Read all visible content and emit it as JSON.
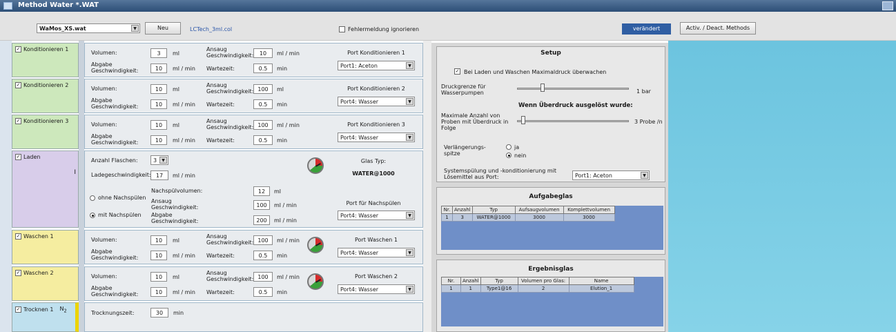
{
  "window": {
    "title": "Method Water *.WAT"
  },
  "toolbar": {
    "method_combo": "WaMos_XS.wat",
    "new_button": "Neu",
    "col_file": "LCTech_3ml.col",
    "error_checkbox": "Fehlermeldung ignorieren",
    "status": "verändert",
    "activ_button": "Activ. / Deact. Methods"
  },
  "colors": {
    "accent": "#2f5ea3",
    "sky": "#6fc3de"
  },
  "side": {
    "k1": "Konditionieren 1",
    "k2": "Konditionieren 2",
    "k3": "Konditionieren 3",
    "laden": "Laden",
    "w1": "Waschen 1",
    "w2": "Waschen 2",
    "t1": "Trocknen 1",
    "n2": "N",
    "n2sub": "2",
    "marker": "I"
  },
  "rows": {
    "k1": {
      "volumen_label": "Volumen:",
      "volumen": "3",
      "volumen_unit": "ml",
      "abgabe_label": "Abgabe Geschwindigkeit:",
      "abgabe": "10",
      "abgabe_unit": "ml / min",
      "ansaug_label": "Ansaug Geschwindigkeit:",
      "ansaug": "10",
      "ansaug_unit": "ml / min",
      "warte_label": "Wartezeit:",
      "warte": "0.5",
      "warte_unit": "min",
      "port_label": "Port Konditionieren 1",
      "port": "Port1: Aceton"
    },
    "k2": {
      "volumen_label": "Volumen:",
      "volumen": "10",
      "volumen_unit": "ml",
      "abgabe_label": "Abgabe Geschwindigkeit:",
      "abgabe": "10",
      "abgabe_unit": "ml / min",
      "ansaug_label": "Ansaug Geschwindigkeit:",
      "ansaug": "100",
      "ansaug_unit": "ml",
      "warte_label": "Wartezeit:",
      "warte": "0.5",
      "warte_unit": "min",
      "port_label": "Port Konditionieren 2",
      "port": "Port4: Wasser"
    },
    "k3": {
      "volumen_label": "Volumen:",
      "volumen": "10",
      "volumen_unit": "ml",
      "abgabe_label": "Abgabe Geschwindigkeit:",
      "abgabe": "10",
      "abgabe_unit": "ml / min",
      "ansaug_label": "Ansaug Geschwindigkeit:",
      "ansaug": "100",
      "ansaug_unit": "ml / min",
      "warte_label": "Wartezeit:",
      "warte": "0.5",
      "warte_unit": "min",
      "port_label": "Port Konditionieren 3",
      "port": "Port4: Wasser"
    },
    "laden": {
      "anzahl_label": "Anzahl Flaschen:",
      "anzahl": "3",
      "ladeg_label": "Ladegeschwindigkeit:",
      "ladeg": "17",
      "ladeg_unit": "ml / min",
      "glas_label": "Glas Typ:",
      "glas": "WATER@1000",
      "nach_vol_label": "Nachspülvolumen:",
      "nach_vol": "12",
      "nach_vol_unit": "ml",
      "ansaug_label": "Ansaug Geschwindigkeit:",
      "ansaug": "100",
      "ansaug_unit": "ml / min",
      "abgabe_label": "Abgabe Geschwindigkeit:",
      "abgabe": "200",
      "abgabe_unit": "ml / min",
      "ohne": "ohne Nachspülen",
      "mit": "mit Nachspülen",
      "port_label": "Port für Nachspülen",
      "port": "Port4: Wasser"
    },
    "w1": {
      "volumen_label": "Volumen:",
      "volumen": "10",
      "volumen_unit": "ml",
      "abgabe_label": "Abgabe Geschwindigkeit:",
      "abgabe": "10",
      "abgabe_unit": "ml / min",
      "ansaug_label": "Ansaug Geschwindigkeit:",
      "ansaug": "100",
      "ansaug_unit": "ml / min",
      "warte_label": "Wartezeit:",
      "warte": "0.5",
      "warte_unit": "min",
      "port_label": "Port Waschen 1",
      "port": "Port4: Wasser"
    },
    "w2": {
      "volumen_label": "Volumen:",
      "volumen": "10",
      "volumen_unit": "ml",
      "abgabe_label": "Abgabe Geschwindigkeit:",
      "abgabe": "10",
      "abgabe_unit": "ml / min",
      "ansaug_label": "Ansaug Geschwindigkeit:",
      "ansaug": "100",
      "ansaug_unit": "ml / min",
      "warte_label": "Wartezeit:",
      "warte": "0.5",
      "warte_unit": "min",
      "port_label": "Port Waschen 2",
      "port": "Port4: Wasser"
    },
    "t1": {
      "label": "Trocknungszeit:",
      "value": "30",
      "unit": "min"
    }
  },
  "setup": {
    "title": "Setup",
    "maxdruck_check": "Bei Laden und Waschen Maximaldruck überwachen",
    "druck_label": "Druckgrenze für Wasserpumpen",
    "druck_value": "1 bar",
    "overpressure_title": "Wenn Überdruck ausgelöst wurde:",
    "proben_label": "Maximale Anzahl von Proben mit Überdruck in Folge",
    "proben_value": "3 Probe /n",
    "verl_label": "Verlängerungs-spitze",
    "ja": "ja",
    "nein": "nein",
    "spuel_label": "Systemspülung und -konditionierung mit Lösemittel aus Port:",
    "spuel_port": "Port1: Aceton"
  },
  "aufgabeglas": {
    "title": "Aufgabeglas",
    "headers": [
      "Nr.",
      "Anzahl",
      "Typ",
      "Aufsaugvolumen",
      "Komplettvolumen"
    ],
    "rows": [
      [
        "1",
        "3",
        "WATER@1000",
        "3000",
        "3000"
      ]
    ]
  },
  "ergebnisglas": {
    "title": "Ergebnisglas",
    "headers": [
      "Nr.",
      "Anzahl",
      "Typ",
      "Volumen pro Glas:",
      "Name"
    ],
    "rows": [
      [
        "1",
        "1",
        "Type1@16",
        "2",
        "Elution_1"
      ]
    ]
  }
}
